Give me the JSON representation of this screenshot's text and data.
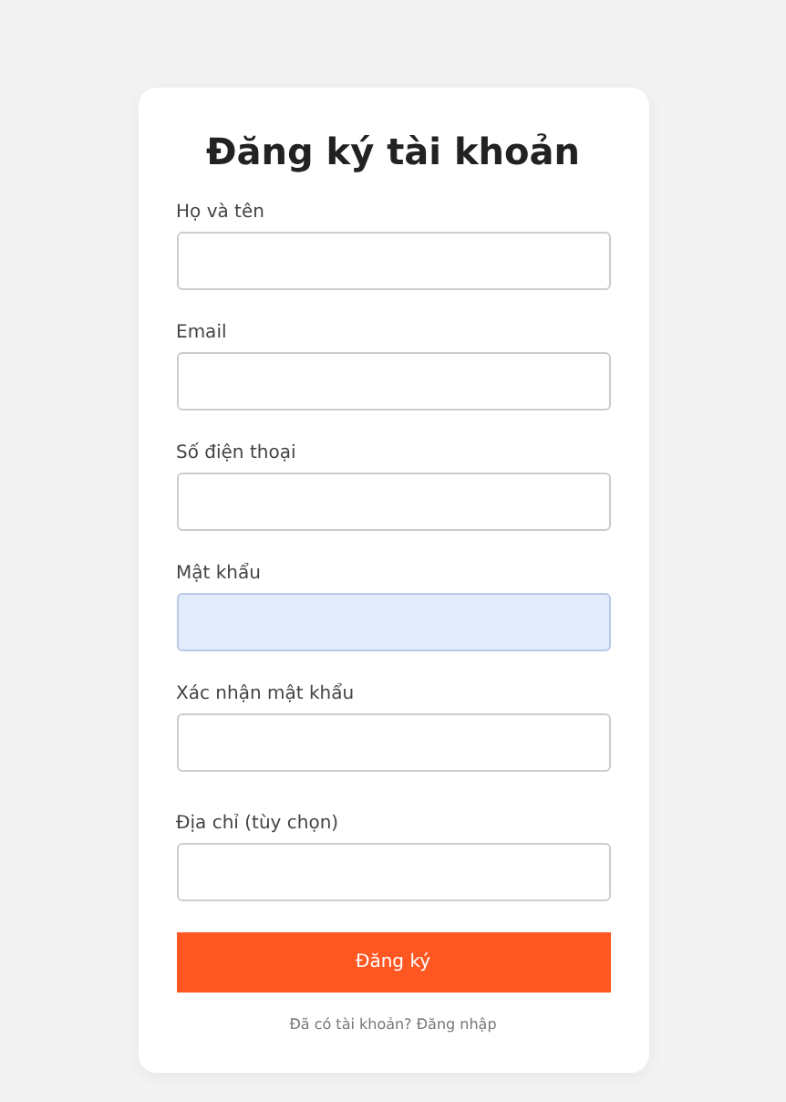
{
  "title": "Đăng ký tài khoản",
  "fields": [
    {
      "label": "Họ và tên",
      "autofilled": false
    },
    {
      "label": "Email",
      "autofilled": false
    },
    {
      "label": "Số điện thoại",
      "autofilled": false
    },
    {
      "label": "Mật khẩu",
      "autofilled": true
    },
    {
      "label": "Xác nhận mật khẩu",
      "autofilled": false
    },
    {
      "label": "Địa chỉ (tùy chọn)",
      "autofilled": false
    }
  ],
  "submit": "Đăng ký",
  "footer": {
    "text": "Đã có tài khoản?",
    "link": "Đăng nhập"
  }
}
